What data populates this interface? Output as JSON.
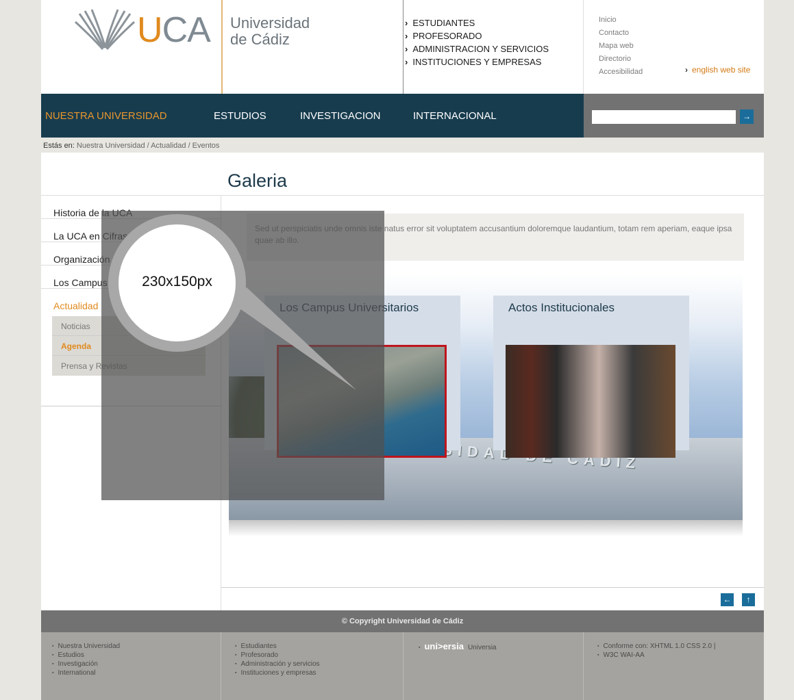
{
  "header": {
    "logo_text_u": "U",
    "logo_text_ca": "CA",
    "university_line1": "Universidad",
    "university_line2": "de Cádiz",
    "top_links": [
      "ESTUDIANTES",
      "PROFESORADO",
      "ADMINISTRACION Y SERVICIOS",
      "INSTITUCIONES Y EMPRESAS"
    ],
    "side_links": [
      "Inicio",
      "Contacto",
      "Mapa web",
      "Directorio",
      "Accesibilidad"
    ],
    "english_link": "english web site"
  },
  "nav": {
    "items": [
      "NUESTRA  UNIVERSIDAD",
      "ESTUDIOS",
      "INVESTIGACION",
      "INTERNACIONAL"
    ],
    "active_color": "#e9952d",
    "search_button": "→"
  },
  "breadcrumb": {
    "label": "Estás en:",
    "path": "Nuestra Universidad  /  Actualidad  /  Eventos"
  },
  "page": {
    "title": "Galeria",
    "intro": "Sed ut perspiciatis unde omnis iste natus error sit voluptatem accusantium doloremque laudantium, totam rem aperiam, eaque ipsa quae ab illo."
  },
  "left_menu": {
    "items": [
      "Historia de la UCA",
      "La UCA en Cifras",
      "Organización",
      "Los Campus",
      "Actualidad"
    ],
    "submenu": [
      "Noticias",
      "Agenda",
      "Prensa y Revistas"
    ]
  },
  "gallery": {
    "cards": [
      "Los Campus Universitarios",
      "Actos Institucionales"
    ],
    "building_text": "UNIVERSIDAD  DE  CADIZ"
  },
  "pager": {
    "prev": "←",
    "up": "↑"
  },
  "footer": {
    "copyright": "© Copyright Universidad de Cádiz",
    "col1": [
      "Nuestra Universidad",
      "Estudios",
      "Investigación",
      "International"
    ],
    "col2": [
      "Estudiantes",
      "Profesorado",
      "Administración y servicios",
      "Instituciones y empresas"
    ],
    "col3_logo": "uni>ersia",
    "col3_text": "Universia",
    "col4": [
      "Conforme con: XHTML 1.0  CSS 2.0 |",
      "W3C  WAI-AA"
    ]
  },
  "overlay": {
    "size_label": "230x150px"
  }
}
